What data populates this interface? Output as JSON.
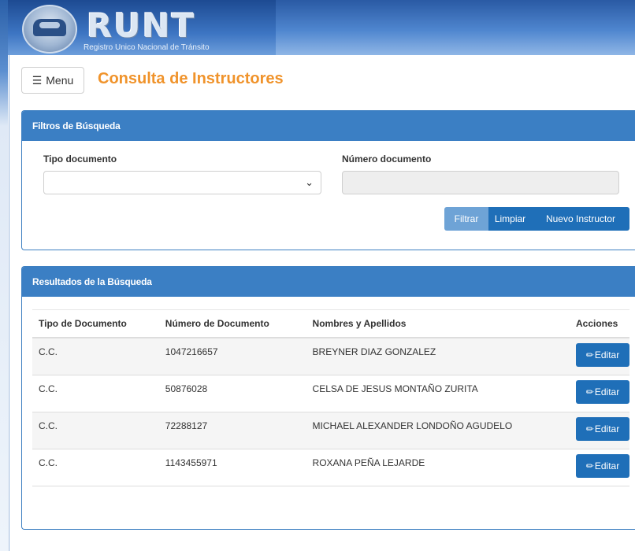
{
  "header": {
    "logo_text": "RUNT",
    "logo_subtitle": "Registro Unico Nacional de Tránsito"
  },
  "toolbar": {
    "menu_icon": "☰",
    "menu_label": "Menu",
    "page_title": "Consulta de Instructores"
  },
  "filters": {
    "title": "Filtros de Búsqueda",
    "tipo_label": "Tipo documento",
    "tipo_value": "",
    "numero_label": "Número documento",
    "numero_value": "",
    "filtrar_label": "Filtrar",
    "limpiar_label": "Limpiar",
    "nuevo_label": "Nuevo Instructor"
  },
  "results": {
    "title": "Resultados de la Búsqueda",
    "columns": [
      "Tipo de Documento",
      "Número de Documento",
      "Nombres y Apellidos",
      "Acciones"
    ],
    "edit_label": "Editar",
    "rows": [
      {
        "tipo": "C.C.",
        "numero": "1047216657",
        "nombre": "BREYNER DIAZ GONZALEZ"
      },
      {
        "tipo": "C.C.",
        "numero": "50876028",
        "nombre": "CELSA DE JESUS MONTAÑO ZURITA"
      },
      {
        "tipo": "C.C.",
        "numero": "72288127",
        "nombre": "MICHAEL ALEXANDER LONDOÑO AGUDELO"
      },
      {
        "tipo": "C.C.",
        "numero": "1143455971",
        "nombre": "ROXANA PEÑA LEJARDE"
      }
    ]
  },
  "colors": {
    "accent": "#f0932b",
    "panel_header": "#3b7fc4",
    "button_primary": "#1f6fb8",
    "button_disabled": "#6ea3d6"
  }
}
